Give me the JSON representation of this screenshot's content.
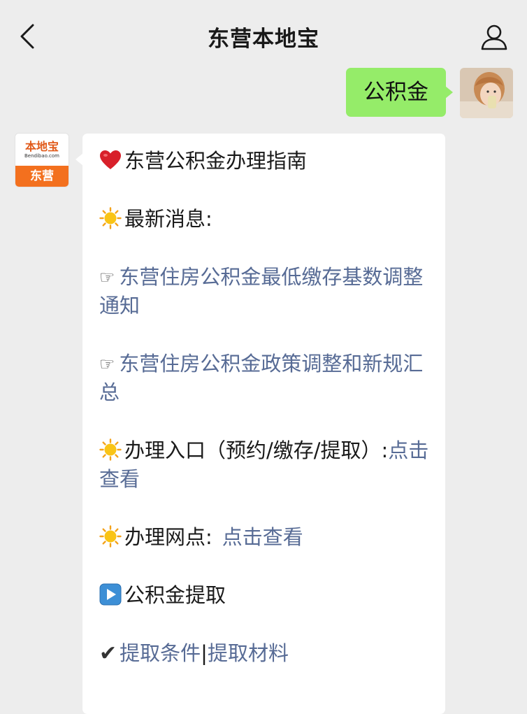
{
  "header": {
    "title": "东营本地宝",
    "back_icon": "chevron-left-icon",
    "profile_icon": "person-icon"
  },
  "outgoing": {
    "text": "公积金",
    "bubble_color": "#95ec69"
  },
  "bot_avatar": {
    "logo_text": "本地宝",
    "logo_url": "Bendibao.com",
    "city": "东营",
    "brand_color": "#f3701e"
  },
  "message": {
    "heading": "东营公积金办理指南",
    "latest_label": "最新消息:",
    "news1": "东营住房公积金最低缴存基数调整通知",
    "news2": "东营住房公积金政策调整和新规汇总",
    "entrance_label": "办理入口（预约/缴存/提取）:",
    "entrance_link": "点击查看",
    "outlets_label": "办理网点:",
    "outlets_link": "点击查看",
    "withdraw_title": "公积金提取",
    "cond_link": "提取条件",
    "separator": "|",
    "material_link": "提取材料",
    "link_color": "#576b95"
  }
}
